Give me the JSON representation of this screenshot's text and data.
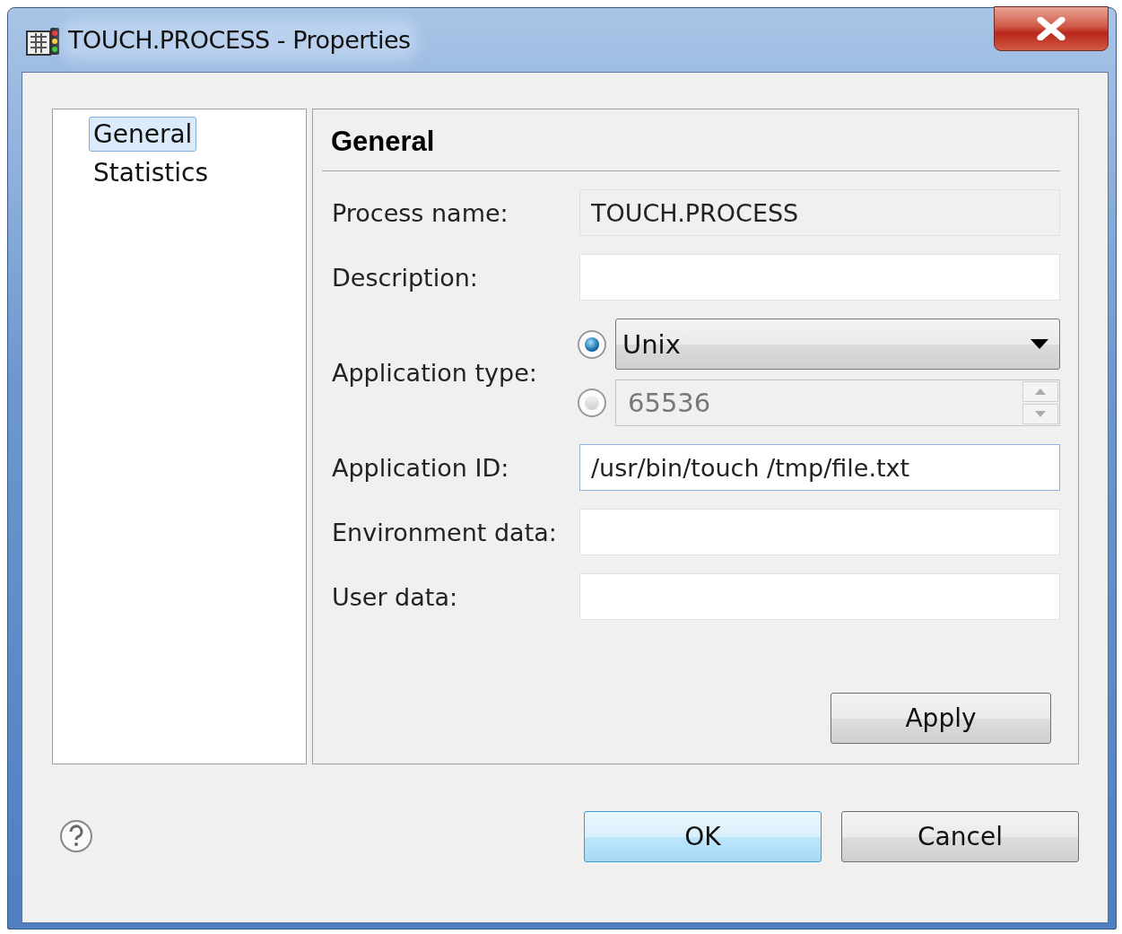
{
  "window": {
    "title": "TOUCH.PROCESS - Properties"
  },
  "sidebar": {
    "items": [
      {
        "label": "General",
        "selected": true
      },
      {
        "label": "Statistics",
        "selected": false
      }
    ]
  },
  "panel": {
    "title": "General",
    "fields": [
      {
        "kind": "text",
        "label": "Process name:",
        "value": "TOUCH.PROCESS",
        "readonly": true,
        "focused": false
      },
      {
        "kind": "text",
        "label": "Description:",
        "readonly": false,
        "focused": false
      },
      {
        "kind": "choice",
        "label": "Application type:",
        "options": [
          {
            "kind": "dropdown",
            "value": "Unix",
            "selected": true
          },
          {
            "kind": "spinner",
            "value": "65536",
            "selected": false
          }
        ]
      },
      {
        "kind": "text",
        "label": "Application ID:",
        "value": "/usr/bin/touch /tmp/file.txt",
        "readonly": false,
        "focused": true
      },
      {
        "kind": "text",
        "label": "Environment data:",
        "readonly": false,
        "focused": false
      },
      {
        "kind": "text",
        "label": "User data:",
        "readonly": false,
        "focused": false
      }
    ],
    "apply": "Apply"
  },
  "buttons": [
    {
      "label": "OK",
      "default": true
    },
    {
      "label": "Cancel",
      "default": false
    }
  ]
}
